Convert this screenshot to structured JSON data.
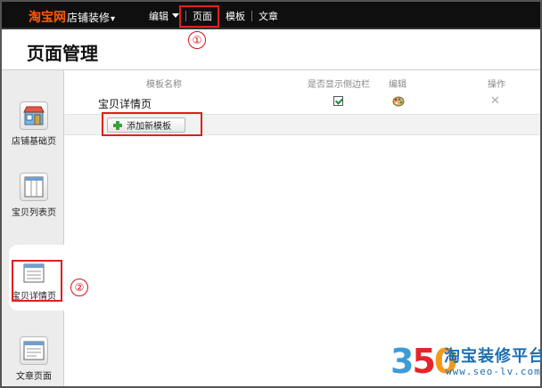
{
  "topbar": {
    "brand": "淘宝网",
    "subtitle": "店铺装修",
    "subtitle_caret": "▾",
    "nav": [
      {
        "label": "编辑"
      },
      {
        "label": "页面"
      },
      {
        "label": "模板"
      },
      {
        "label": "文章"
      }
    ]
  },
  "annotations": {
    "step1": "①",
    "step2": "②"
  },
  "header": {
    "title": "页面管理"
  },
  "sidebar": {
    "items": [
      {
        "label": "店铺基础页",
        "icon": "shop-icon"
      },
      {
        "label": "宝贝列表页",
        "icon": "list-page-icon"
      },
      {
        "label": "宝贝详情页",
        "icon": "detail-page-icon"
      },
      {
        "label": "文章页面",
        "icon": "article-page-icon"
      }
    ]
  },
  "table": {
    "columns": {
      "name": "模板名称",
      "show_sidebar": "是否显示侧边栏",
      "edit": "编辑",
      "action": "操作"
    },
    "rows": [
      {
        "name": "宝贝详情页",
        "show_sidebar": true
      }
    ],
    "add_button": "添加新模板"
  },
  "watermark": {
    "digits": [
      "3",
      "5",
      "0"
    ],
    "name": "淘宝装修平台",
    "url": "www.seo-lv.com"
  },
  "colors": {
    "highlight": "#e0201a",
    "brand": "#ff5a00",
    "topbar": "#0f0f0f"
  }
}
